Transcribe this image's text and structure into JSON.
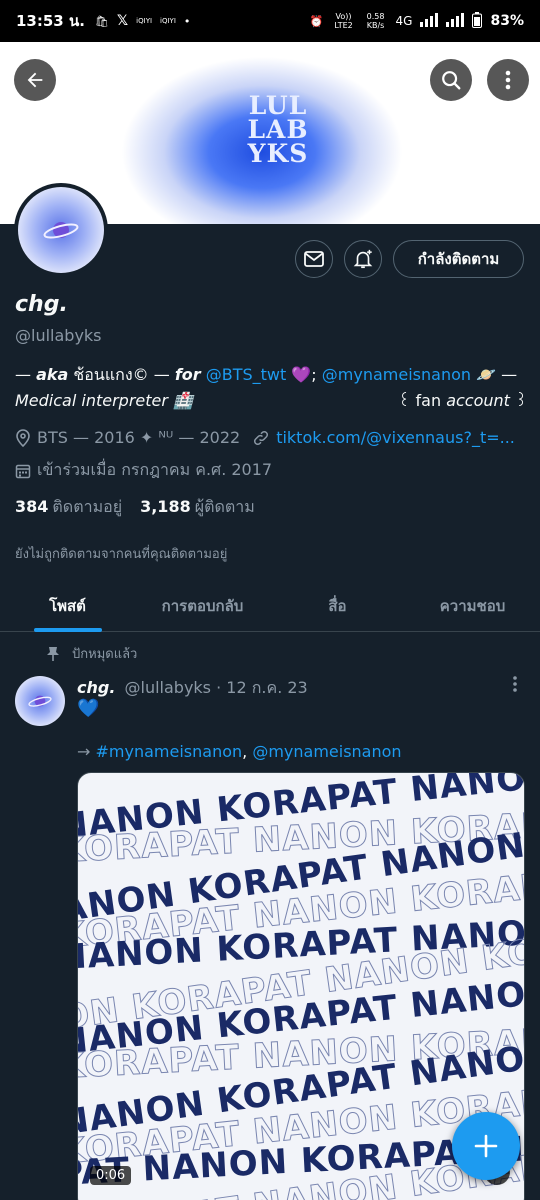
{
  "status_bar": {
    "time": "13:53 น.",
    "volte": "Vo)) LTE2",
    "speed": "0.58 KB/s",
    "network": "4G",
    "battery": "83%"
  },
  "banner": {
    "logo_text": "LUL LAB YKS"
  },
  "profile": {
    "name": "chg.",
    "handle": "@lullabyks",
    "follow_button": "กำลังติดตาม",
    "bio": {
      "prefix": "— ",
      "aka": "aka",
      "aka_text": " ช้อนแกง© — ",
      "for": "for",
      "mention1": "@BTS_twt",
      "heart": " 💜; ",
      "mention2": "@mynameisnanon",
      "line1_end": " 🪐 —",
      "line2_a": "Medical interpreter 🏥",
      "line2_b": "꒰ fan ",
      "line2_c": "account",
      "line2_d": " ꒱"
    },
    "location": "BTS — 2016 ✦ ᴺᵁ — 2022",
    "website": "tiktok.com/@vixennaus?_t=...",
    "joined": "เข้าร่วมเมื่อ กรกฎาคม ค.ศ. 2017",
    "following_count": "384",
    "following_label": "ติดตามอยู่",
    "followers_count": "3,188",
    "followers_label": "ผู้ติดตาม",
    "not_followed_text": "ยังไม่ถูกติดตามจากคนที่คุณติดตามอยู่"
  },
  "tabs": [
    {
      "label": "โพสต์",
      "active": true
    },
    {
      "label": "การตอบกลับ",
      "active": false
    },
    {
      "label": "สื่อ",
      "active": false
    },
    {
      "label": "ความชอบ",
      "active": false
    }
  ],
  "post": {
    "pinned_label": "ปักหมุดแล้ว",
    "author_name": "chg.",
    "author_handle": "@lullabyks",
    "date": "· 12 ก.ค. 23",
    "text1": "💙",
    "text2_prefix": "→ ",
    "hashtag": "#mynameisnanon",
    "text2_sep": ", ",
    "mention": "@mynameisnanon",
    "media_duration": "0:06",
    "media_rows": [
      "NANON KORAPAT NANON",
      "KORAPAT NANON KORAPAT",
      "ANON KORAPAT NANON KO",
      "KORAPAT NANON KORAPAT",
      "NANON KORAPAT NANON",
      "ON KORAPAT NANON KORA",
      "NANON KORAPAT NANON",
      "KORAPAT NANON KORAPAT",
      "NANON KORAPAT NANON",
      "KORAPAT NANON KORAPAT",
      "PAT NANON KORAPAT NA",
      "KORAPAT NANON KORAPAT"
    ]
  },
  "colors": {
    "accent": "#1d9bf0",
    "background": "#15202b",
    "muted": "#8b98a5"
  }
}
